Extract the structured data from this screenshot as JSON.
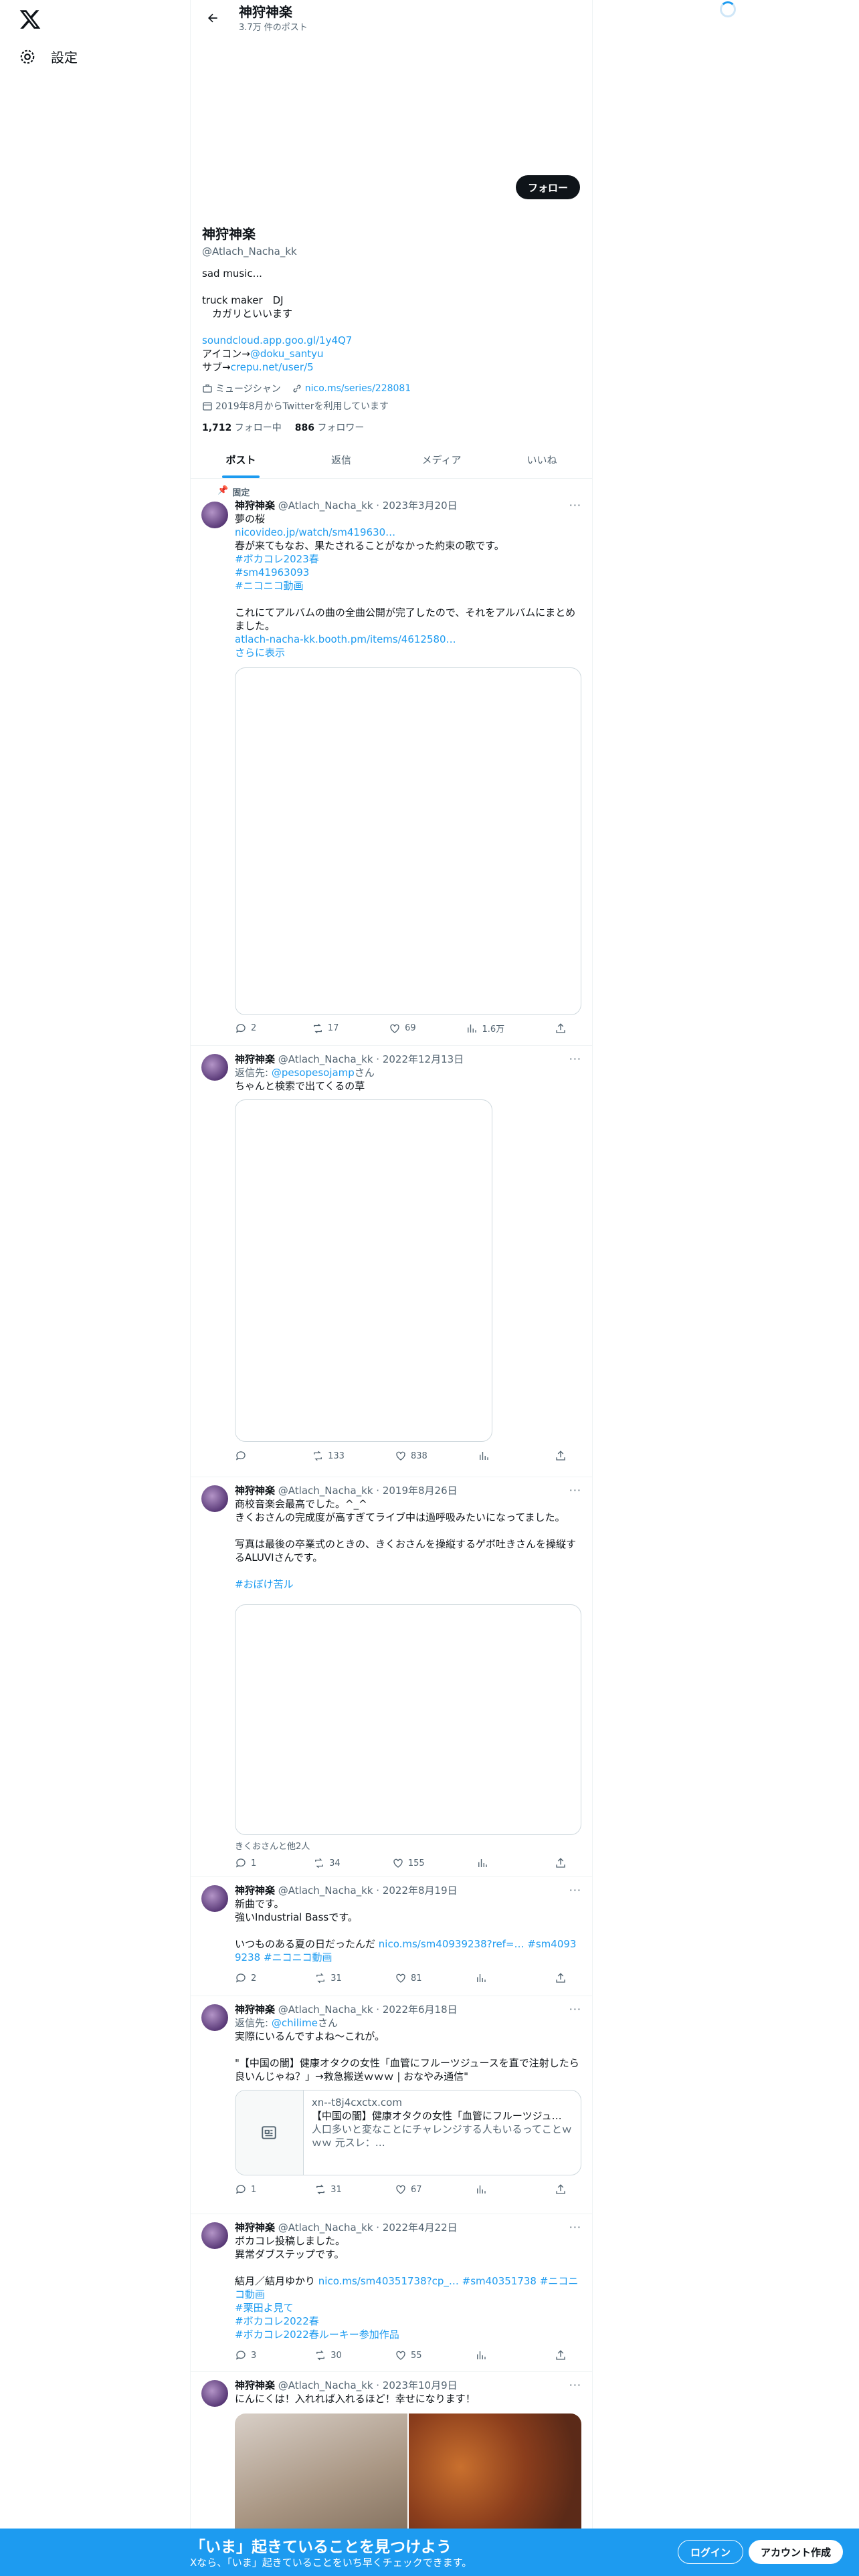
{
  "nav": {
    "settings": "設定"
  },
  "header": {
    "name": "神狩神楽",
    "posts": "3.7万 件のポスト"
  },
  "profile": {
    "follow": "フォロー",
    "name": "神狩神楽",
    "handle": "@Atlach_Nacha_kk",
    "bio1": "sad music...\n\ntruck maker　DJ\n　カガリといいます",
    "link1": "soundcloud.app.goo.gl/1y4Q7",
    "bio2": "アイコン→",
    "link2": "@doku_santyu",
    "bio3": "サブ→",
    "link3": "crepu.net/user/5",
    "category": "ミュージシャン",
    "site": "nico.ms/series/228081",
    "joined": "2019年8月からTwitterを利用しています",
    "following_n": "1,712",
    "following": "フォロー中",
    "followers_n": "886",
    "followers": "フォロワー"
  },
  "tabs": [
    "ポスト",
    "返信",
    "メディア",
    "いいね"
  ],
  "tweets": [
    {
      "pinned": "固定",
      "name": "神狩神楽",
      "meta": "@Atlach_Nacha_kk · 2023年3月20日",
      "l1": "夢の桜",
      "link_a": "nicovideo.jp/watch/sm419630…",
      "l2": "春が来てもなお、果たされることがなかった約束の歌です。",
      "tags": "#ボカコレ2023春\n#sm41963093\n#ニコニコ動画",
      "l3": "これにてアルバムの曲の全曲公開が完了したので、それをアルバムにまとめました。",
      "link_b": "atlach-nacha-kk.booth.pm/items/4612580…",
      "more": "さらに表示",
      "reply": "2",
      "rt": "17",
      "like": "69",
      "view": "1.6万"
    },
    {
      "name": "神狩神楽",
      "meta": "@Atlach_Nacha_kk · 2022年12月13日",
      "reply_to": "返信先: ",
      "reply_h": "@pesopesojamp",
      "reply_s": "さん",
      "l1": "ちゃんと検索で出てくるの草",
      "reply": "",
      "rt": "133",
      "like": "838",
      "view": ""
    },
    {
      "name": "神狩神楽",
      "meta": "@Atlach_Nacha_kk · 2019年8月26日",
      "l1": "商校音楽会最高でした。^_^\nきくおさんの完成度が高すぎてライブ中は過呼吸みたいになってました。\n\n写真は最後の卒業式のときの、きくおさんを操縦するゲボ吐きさんを操縦するALUVIさんです。",
      "tag": "#おぼけ苦ル",
      "caption": "きくおさんと他2人",
      "reply": "1",
      "rt": "34",
      "like": "155",
      "view": ""
    },
    {
      "name": "神狩神楽",
      "meta": "@Atlach_Nacha_kk · 2022年8月19日",
      "l1": "新曲です。\n強いIndustrial Bassです。\n\nいつものある夏の日だったんだ ",
      "link": "nico.ms/sm40939238?ref=… #sm40939238 #ニコニコ動画",
      "reply": "2",
      "rt": "31",
      "like": "81",
      "view": ""
    },
    {
      "name": "神狩神楽",
      "meta": "@Atlach_Nacha_kk · 2022年6月18日",
      "reply_to": "返信先: ",
      "reply_h": "@chilime",
      "reply_s": "さん",
      "l1": "実際にいるんですよね〜これが。\n\n\"【中国の闇】健康オタクの女性「血管にフルーツジュースを直で注射したら良いんじゃね？」→救急搬送ｗｗｗ | おなやみ通信\"",
      "card_dom": "xn--t8j4cxctx.com",
      "card_title": "【中国の闇】健康オタクの女性「血管にフルーツジュ…",
      "card_desc": "人口多いと変なことにチャレンジする人もいるってことｗｗｗ 元スレ：…",
      "reply": "1",
      "rt": "31",
      "like": "67",
      "view": ""
    },
    {
      "name": "神狩神楽",
      "meta": "@Atlach_Nacha_kk · 2022年4月22日",
      "l1": "ボカコレ投稿しました。\n異常ダブステップです。\n\n結月／結月ゆかり ",
      "link": "nico.ms/sm40351738?cp_… #sm40351738 #ニコニコ動画\n#栗田よ見て\n#ボカコレ2022春\n#ボカコレ2022春ルーキー参加作品",
      "reply": "3",
      "rt": "30",
      "like": "55",
      "view": ""
    },
    {
      "name": "神狩神楽",
      "meta": "@Atlach_Nacha_kk · 2023年10月9日",
      "l1": "にんにくは！入れれば入れるほど！幸せになります！"
    }
  ],
  "bottom": {
    "title": "「いま」起きていることを見つけよう",
    "sub": "Xなら、「いま」起きていることをいち早くチェックできます。",
    "login": "ログイン",
    "signup": "アカウント作成"
  }
}
